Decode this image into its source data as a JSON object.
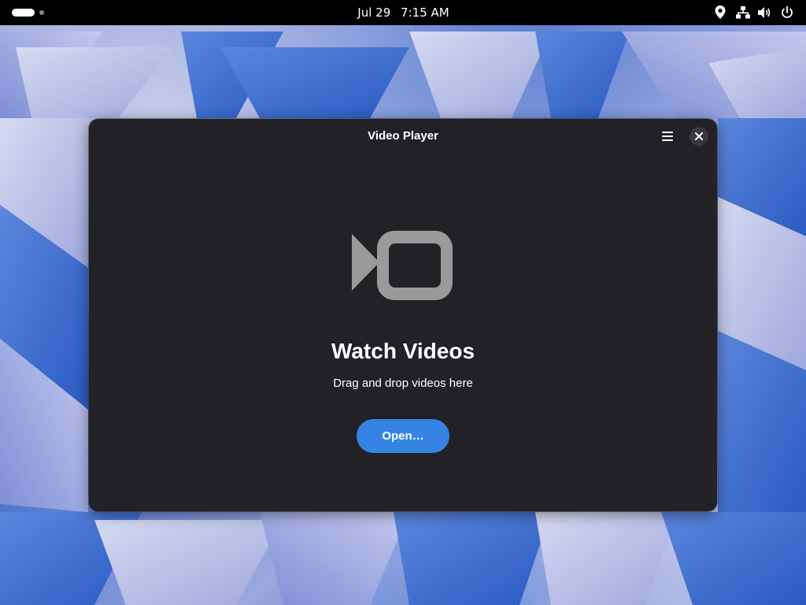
{
  "topbar": {
    "date": "Jul 29",
    "time": "7:15 AM",
    "tray_icons": [
      "location-icon",
      "network-icon",
      "volume-icon",
      "power-icon"
    ]
  },
  "window": {
    "title": "Video Player",
    "menu_icon": "hamburger-menu-icon",
    "close_icon": "close-icon"
  },
  "empty_state": {
    "icon": "video-camera-icon",
    "title": "Watch Videos",
    "subtitle": "Drag and drop videos here",
    "open_button_label": "Open…"
  },
  "colors": {
    "window_bg": "#222226",
    "accent": "#3584e4",
    "icon_gray": "#9a9a9a"
  }
}
